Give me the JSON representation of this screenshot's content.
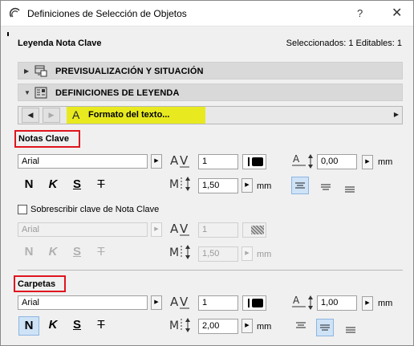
{
  "window": {
    "title": "Definiciones de Selección de Objetos",
    "help_glyph": "?",
    "close_glyph": "✕"
  },
  "header": {
    "left": "Leyenda Nota Clave",
    "right": "Seleccionados: 1 Editables: 1"
  },
  "sections": [
    {
      "label": "PREVISUALIZACIÓN Y SITUACIÓN",
      "expanded": false
    },
    {
      "label": "DEFINICIONES DE LEYENDA",
      "expanded": true
    }
  ],
  "nav": {
    "page_label": "Formato del texto...",
    "highlight_color": "#e8ea1f"
  },
  "notas_clave": {
    "title": "Notas Clave",
    "font": "Arial",
    "pen": "1",
    "size": "0,00",
    "spacing": "1,50",
    "unit": "mm",
    "styles": [
      "N",
      "K",
      "S",
      "T"
    ],
    "align_active": "left"
  },
  "override": {
    "checkbox_label": "Sobrescribir clave de Nota Clave",
    "checked": false,
    "font": "Arial",
    "pen": "1",
    "spacing": "1,50",
    "unit": "mm",
    "styles": [
      "N",
      "K",
      "S",
      "T"
    ]
  },
  "carpetas": {
    "title": "Carpetas",
    "font": "Arial",
    "pen": "1",
    "size": "1,00",
    "spacing": "2,00",
    "unit": "mm",
    "styles": [
      "N",
      "K",
      "S",
      "T"
    ],
    "style_active": "N",
    "align_active": "center"
  },
  "colors": {
    "highlight_outline": "#e0141e",
    "active_button": "#cfe3f7"
  }
}
